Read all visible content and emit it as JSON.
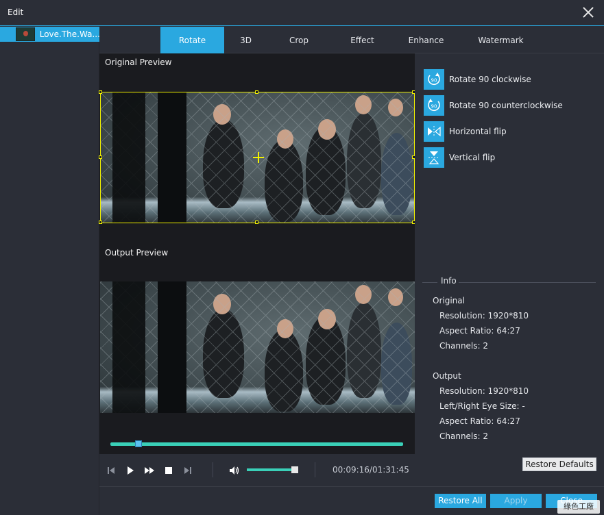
{
  "window": {
    "title": "Edit"
  },
  "sidebar": {
    "items": [
      {
        "label": "Love.The.Wa..."
      }
    ]
  },
  "tabs": [
    {
      "label": "Rotate",
      "active": true
    },
    {
      "label": "3D"
    },
    {
      "label": "Crop"
    },
    {
      "label": "Effect"
    },
    {
      "label": "Enhance"
    },
    {
      "label": "Watermark"
    }
  ],
  "preview": {
    "original_label": "Original Preview",
    "output_label": "Output Preview"
  },
  "playback": {
    "timecode": "00:09:16/01:31:45",
    "progress_fraction": 0.096,
    "volume_fraction": 0.9
  },
  "actions": [
    {
      "label": "Rotate 90 clockwise",
      "icon": "rotate-clockwise-icon"
    },
    {
      "label": "Rotate 90 counterclockwise",
      "icon": "rotate-counterclockwise-icon"
    },
    {
      "label": "Horizontal flip",
      "icon": "horizontal-flip-icon"
    },
    {
      "label": "Vertical flip",
      "icon": "vertical-flip-icon"
    }
  ],
  "info": {
    "title": "Info",
    "original_heading": "Original",
    "original_resolution": "Resolution: 1920*810",
    "original_aspect": "Aspect Ratio: 64:27",
    "original_channels": "Channels: 2",
    "output_heading": "Output",
    "output_resolution": "Resolution: 1920*810",
    "output_eye_size": "Left/Right Eye Size: -",
    "output_aspect": "Aspect Ratio: 64:27",
    "output_channels": "Channels: 2"
  },
  "buttons": {
    "restore_defaults": "Restore Defaults",
    "restore_all": "Restore All",
    "apply": "Apply",
    "close": "Close"
  },
  "watermark_text": "綠色工廠",
  "colors": {
    "accent": "#2aa8e0",
    "crop_box": "#f2f200",
    "seek": "#3ad0b8"
  }
}
